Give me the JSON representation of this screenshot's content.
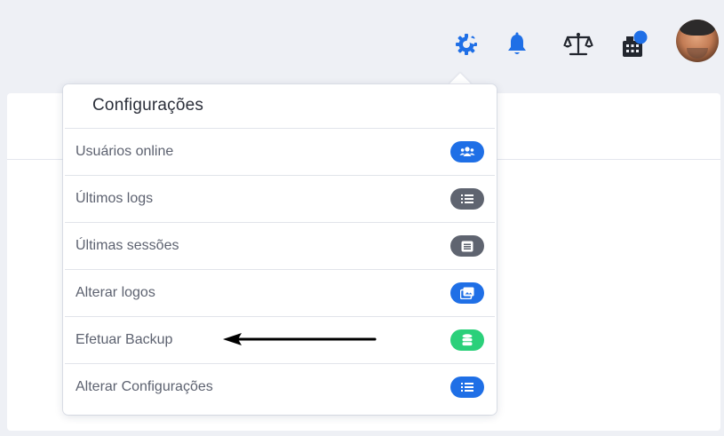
{
  "topbar": {
    "icons": [
      {
        "name": "settings-gear-icon",
        "color": "#1f6fe6"
      },
      {
        "name": "bell-icon",
        "color": "#1f6fe6"
      },
      {
        "name": "scale-icon",
        "color": "#22262e"
      },
      {
        "name": "building-icon",
        "color": "#22262e",
        "badge_color": "#1f6fe6"
      }
    ],
    "avatar": "user-avatar"
  },
  "dropdown": {
    "title": "Configurações",
    "items": [
      {
        "label": "Usuários online",
        "icon": "users-icon",
        "color": "#1f6fe6"
      },
      {
        "label": "Últimos logs",
        "icon": "list-icon",
        "color": "#5f6470"
      },
      {
        "label": "Últimas sessões",
        "icon": "list-box-icon",
        "color": "#5f6470"
      },
      {
        "label": "Alterar logos",
        "icon": "images-icon",
        "color": "#1f6fe6"
      },
      {
        "label": "Efetuar Backup",
        "icon": "database-icon",
        "color": "#2bd07a"
      },
      {
        "label": "Alterar Configurações",
        "icon": "list-icon",
        "color": "#1f6fe6"
      }
    ]
  },
  "annotation": {
    "name": "pointer-arrow",
    "color": "#000000"
  }
}
